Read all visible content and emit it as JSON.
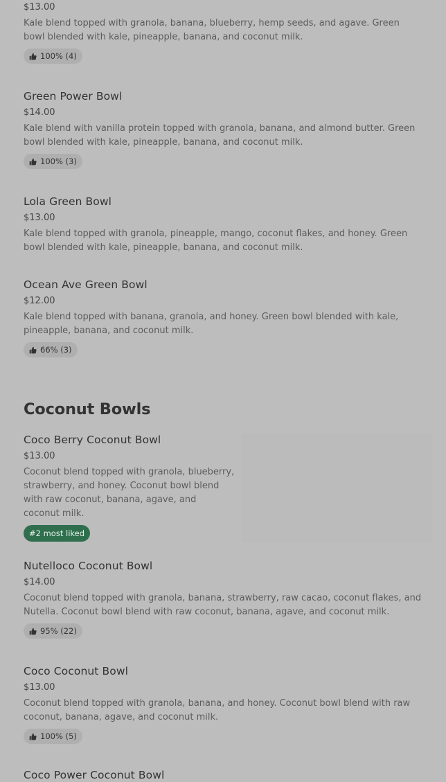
{
  "items": [
    {
      "price": "$13.00",
      "description": "Kale blend topped with granola, banana, blueberry, hemp seeds, and agave. Green bowl blended with kale, pineapple, banana, and coconut milk.",
      "rating": "100% (4)"
    },
    {
      "name": "Green Power Bowl",
      "price": "$14.00",
      "description": "Kale blend with vanilla protein topped with granola, banana, and almond butter. Green bowl blended with kale, pineapple, banana, and coconut milk.",
      "rating": "100% (3)"
    },
    {
      "name": "Lola Green Bowl",
      "price": "$13.00",
      "description": "Kale blend topped with granola, pineapple, mango, coconut flakes, and honey. Green bowl blended with kale, pineapple, banana, and coconut milk."
    },
    {
      "name": "Ocean Ave Green Bowl",
      "price": "$12.00",
      "description": "Kale blend topped with banana, granola, and honey. Green bowl blended with kale, pineapple, banana, and coconut milk.",
      "rating": "66% (3)"
    }
  ],
  "coconut_section": {
    "title": "Coconut Bowls",
    "items": [
      {
        "name": "Coco Berry Coconut Bowl",
        "price": "$13.00",
        "description": "Coconut blend topped with granola, blueberry, strawberry, and honey. Coconut bowl blend with raw coconut, banana, agave, and coconut milk.",
        "badge": "#2 most liked"
      },
      {
        "name": "Nutelloco Coconut Bowl",
        "price": "$14.00",
        "description": "Coconut blend topped with granola, banana, strawberry, raw cacao, coconut flakes, and Nutella. Coconut bowl blend with raw coconut, banana, agave, and coconut milk.",
        "rating": "95% (22)"
      },
      {
        "name": "Coco Coconut Bowl",
        "price": "$13.00",
        "description": "Coconut blend topped with granola, banana, and honey. Coconut bowl blend with raw coconut, banana, agave, and coconut milk.",
        "rating": "100% (5)"
      },
      {
        "name": "Coco Power Coconut Bowl"
      }
    ]
  },
  "icons": {
    "rating": "thumbs-up-icon"
  },
  "colors": {
    "background": "#bdbdbd",
    "badge": "#2f6f4d"
  }
}
